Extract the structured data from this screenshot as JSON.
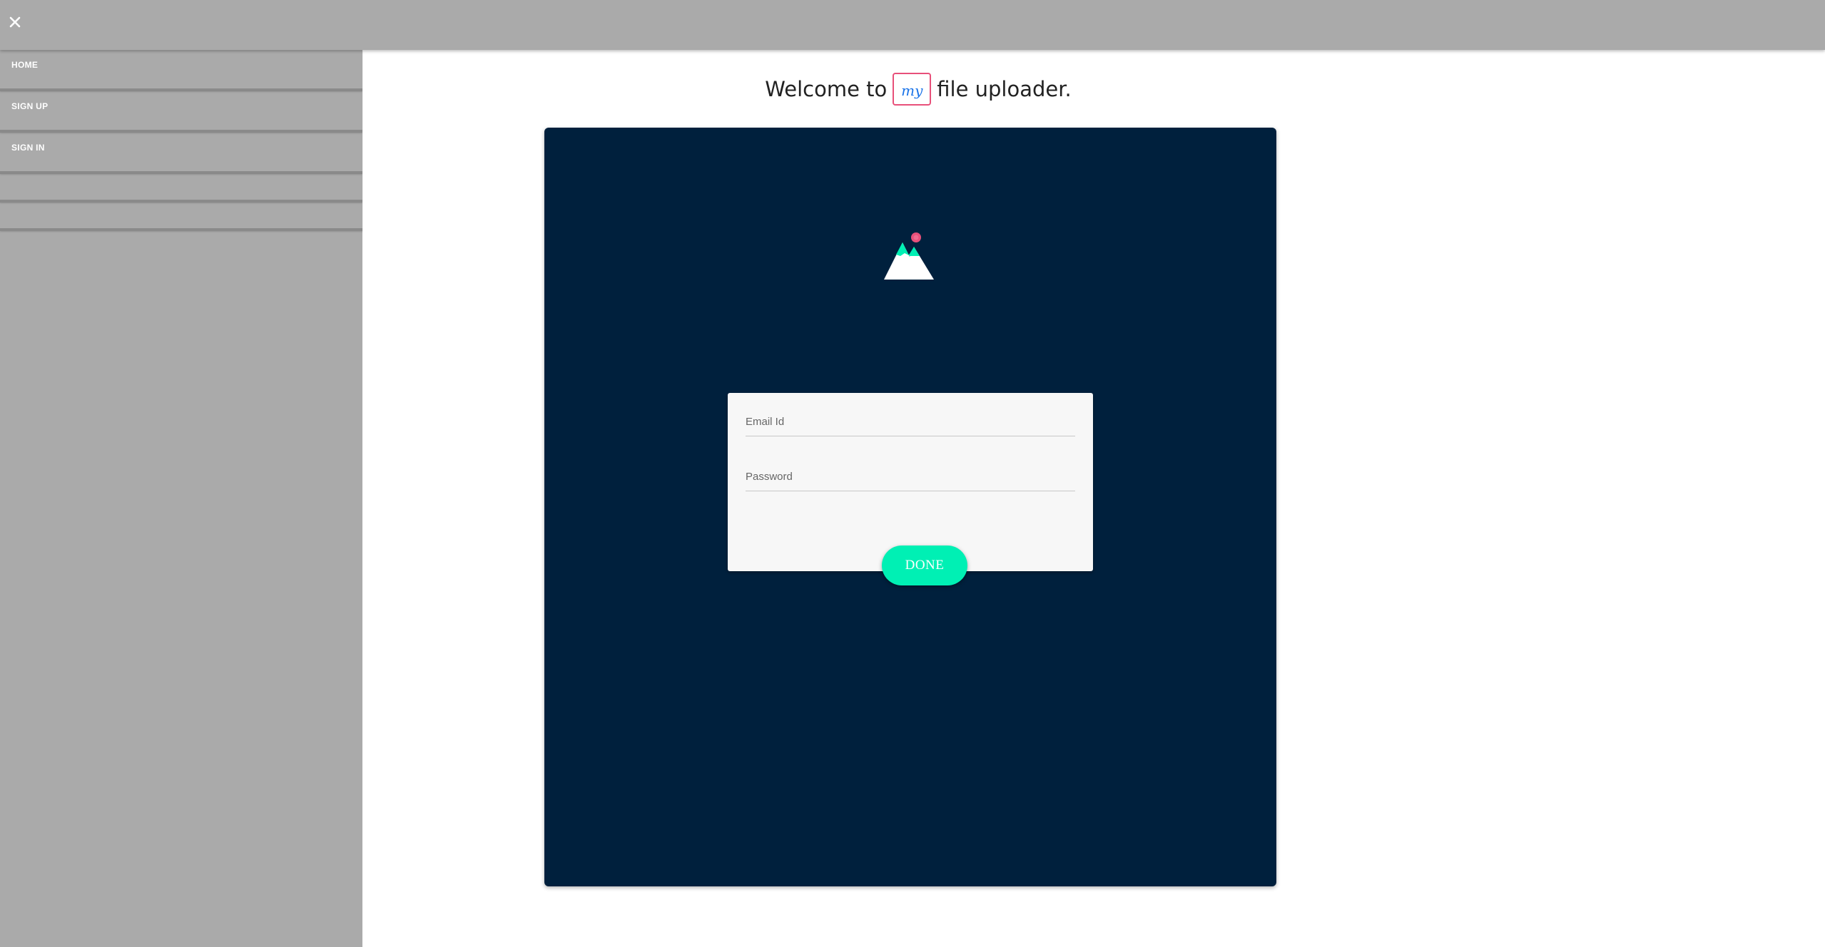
{
  "topbar": {
    "close_icon": "close-icon",
    "close_color": "#ffffff"
  },
  "sidebar": {
    "items": [
      {
        "label": "HOME"
      },
      {
        "label": "SIGN UP"
      },
      {
        "label": "SIGN IN"
      },
      {
        "label": ""
      },
      {
        "label": ""
      }
    ]
  },
  "header": {
    "welcome_prefix": "Welcome to",
    "badge_text": "my",
    "welcome_suffix": "file uploader."
  },
  "form": {
    "email_placeholder": "Email Id",
    "password_placeholder": "Password",
    "email_value": "",
    "password_value": "",
    "submit_label": "DONE"
  },
  "colors": {
    "topbar": "#aaaaaa",
    "panel": "#00203d",
    "accent": "#00f0b4",
    "badge_border": "#e8507a",
    "badge_text": "#1a73e8",
    "logo_dot": "#e8507a"
  },
  "logo": {
    "icon": "mountain-logo-icon"
  }
}
